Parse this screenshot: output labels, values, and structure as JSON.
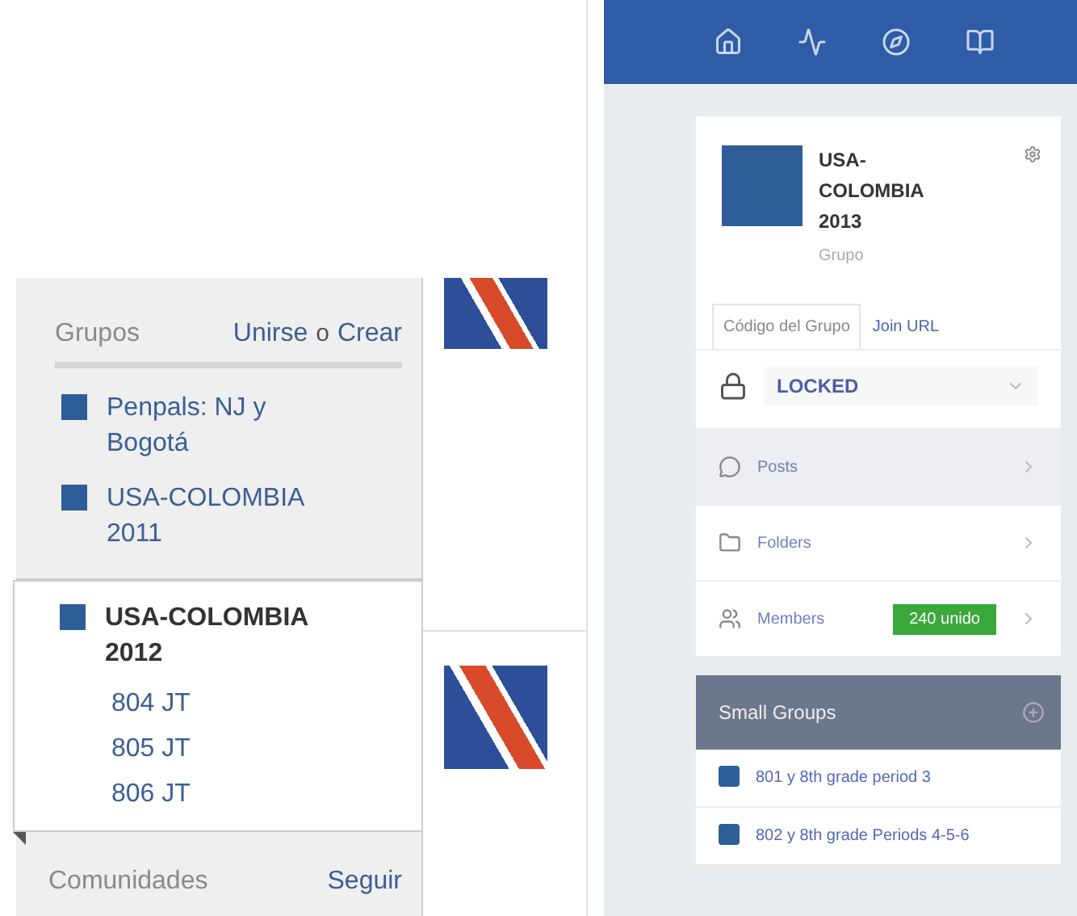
{
  "groups_panel": {
    "title": "Grupos",
    "join_link": "Unirse",
    "separator": "o",
    "create_link": "Crear",
    "groups": [
      {
        "name": "Penpals: NJ y Bogotá",
        "selected": false
      },
      {
        "name": "USA-COLOMBIA 2011",
        "selected": false
      },
      {
        "name": "USA-COLOMBIA 2012",
        "selected": true,
        "subgroups": [
          "804 JT",
          "805 JT",
          "806 JT"
        ]
      }
    ],
    "communities": {
      "title": "Comunidades",
      "follow_link": "Seguir"
    }
  },
  "group_page": {
    "card": {
      "name": "USA-COLOMBIA 2013",
      "type": "Grupo",
      "tabs": [
        {
          "label": "Código del Grupo",
          "selected": true
        },
        {
          "label": "Join URL",
          "selected": false
        }
      ],
      "lock_status": "LOCKED",
      "menu": [
        {
          "kind": "posts",
          "label": "Posts",
          "selected": true
        },
        {
          "kind": "folders",
          "label": "Folders",
          "selected": false
        },
        {
          "kind": "members",
          "label": "Members",
          "selected": false,
          "badge": "240 unido"
        }
      ]
    },
    "small_groups": {
      "title": "Small Groups",
      "items": [
        "801 y 8th grade period 3",
        "802 y 8th grade Periods 4-5-6"
      ]
    }
  }
}
